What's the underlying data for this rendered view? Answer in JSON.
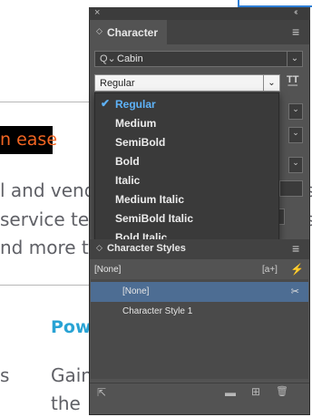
{
  "document": {
    "highlight": "n ease",
    "lines": [
      "l and vend",
      "service tear",
      "nd more ti"
    ],
    "right_fragments": [
      "s",
      "s"
    ],
    "heading": "Pow",
    "side_label": "s",
    "body_lines": [
      "Gain",
      "the"
    ]
  },
  "panel": {
    "close_glyph": "×",
    "collapse_glyph": "‹‹",
    "tab_icon": "◇",
    "tab_label": "Character",
    "menu_glyph": "≡",
    "font_family": {
      "icon": "search-icon",
      "icon_glyph": "Q⌄",
      "value": "Cabin",
      "chevron": "⌄"
    },
    "font_style": {
      "value": "Regular",
      "chevron": "⌄",
      "tt_glyph": "T͟T"
    },
    "style_options": [
      {
        "label": "Regular",
        "selected": true
      },
      {
        "label": "Medium",
        "selected": false
      },
      {
        "label": "SemiBold",
        "selected": false
      },
      {
        "label": "Bold",
        "selected": false
      },
      {
        "label": "Italic",
        "selected": false
      },
      {
        "label": "Medium Italic",
        "selected": false
      },
      {
        "label": "SemiBold Italic",
        "selected": false
      },
      {
        "label": "Bold Italic",
        "selected": false
      }
    ],
    "check_glyph": "✔",
    "char_styles": {
      "header_icon": "◇",
      "header_label": "Character Styles",
      "current": "[None]",
      "new_style_glyph": "[a+]",
      "bolt_glyph": "⚡",
      "items": [
        {
          "label": "[None]",
          "selected": true
        },
        {
          "label": "Character Style 1",
          "selected": false
        }
      ],
      "tool_glyph": "✂"
    },
    "bottom_icons": {
      "load": "⇱",
      "folder": "▬",
      "add": "⊞",
      "trash": "🗑"
    }
  },
  "colors": {
    "panel_bg": "#535353",
    "accent_blue": "#5eb2f7",
    "selection": "#4d6d93",
    "doc_heading": "#29a3d4",
    "doc_highlight": "#f26522"
  }
}
